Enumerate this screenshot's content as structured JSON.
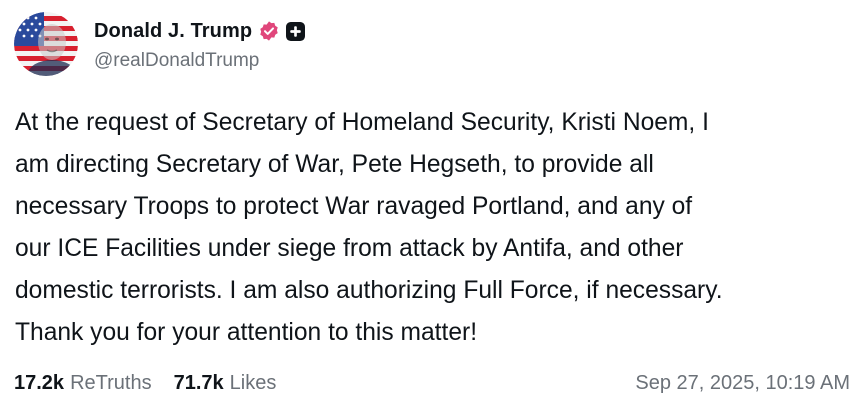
{
  "author": {
    "display_name": "Donald J. Trump",
    "handle": "@realDonaldTrump",
    "avatar": "flag-portrait-avatar",
    "verified_icon": "verified-badge-icon",
    "verified_color": "#e0467b",
    "plus_icon": "plus-badge-icon"
  },
  "post": {
    "text": "At the request of Secretary of Homeland Security, Kristi Noem, I\nam directing Secretary of War, Pete Hegseth, to provide all\nnecessary Troops to protect War ravaged Portland, and any of\nour ICE Facilities under siege from attack by Antifa, and other\ndomestic terrorists. I am also authorizing Full Force, if necessary.\nThank you for your attention to this matter!"
  },
  "stats": {
    "retruths_count": "17.2k",
    "retruths_label": "ReTruths",
    "likes_count": "71.7k",
    "likes_label": "Likes"
  },
  "timestamp": "Sep 27, 2025, 10:19 AM"
}
